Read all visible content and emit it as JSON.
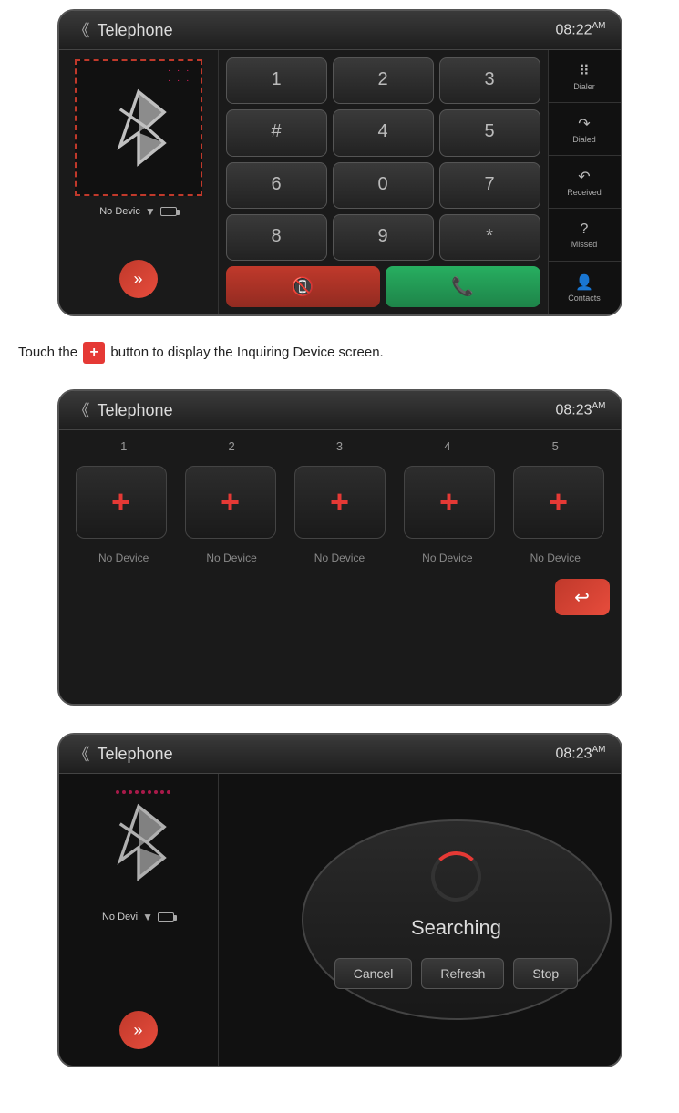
{
  "screen1": {
    "title": "Telephone",
    "time": "08:22",
    "am": "AM",
    "device_label": "No Devic",
    "dialpad": {
      "keys": [
        "1",
        "2",
        "3",
        "#",
        "4",
        "5",
        "6",
        "0",
        "7",
        "8",
        "9",
        "*"
      ]
    },
    "right_menu": [
      {
        "label": "Dialer",
        "icon": "grid"
      },
      {
        "label": "Dialed",
        "icon": "arrow-right"
      },
      {
        "label": "Received",
        "icon": "arrow-left"
      },
      {
        "label": "Missed",
        "icon": "question"
      },
      {
        "label": "Contacts",
        "icon": "person"
      }
    ]
  },
  "instruction": {
    "text_before": "Touch the ",
    "text_after": " button to display the Inquiring Device screen.",
    "button_label": "+"
  },
  "screen2": {
    "title": "Telephone",
    "time": "08:23",
    "am": "AM",
    "slots": [
      {
        "number": "1",
        "label": "No Device"
      },
      {
        "number": "2",
        "label": "No Device"
      },
      {
        "number": "3",
        "label": "No Device"
      },
      {
        "number": "4",
        "label": "No Device"
      },
      {
        "number": "5",
        "label": "No Device"
      }
    ],
    "back_icon": "↩"
  },
  "screen3": {
    "title": "Telephone",
    "time": "08:23",
    "am": "AM",
    "device_label": "No Devi",
    "searching_text": "Searching",
    "buttons": {
      "cancel": "Cancel",
      "refresh": "Refresh",
      "stop": "Stop"
    }
  }
}
